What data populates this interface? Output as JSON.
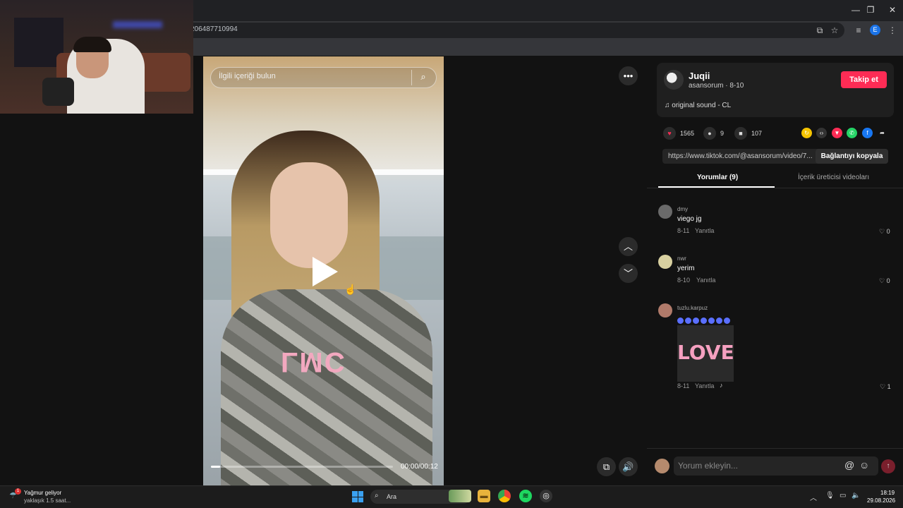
{
  "browser": {
    "url": "206487710994",
    "window_controls": [
      "—",
      "❐",
      "✕"
    ]
  },
  "video": {
    "search_placeholder": "İlgili içeriği bulun",
    "overlay_logo": "LMC",
    "time": "00:00/00:12",
    "progress_fraction": 0.05
  },
  "author": {
    "name": "Juqii",
    "subtitle": "asansorum · 8-10",
    "follow_label": "Takip et",
    "sound": "original sound - CL"
  },
  "stats": {
    "likes": "1565",
    "comments": "9",
    "saves": "107"
  },
  "link": {
    "url": "https://www.tiktok.com/@asansorum/video/7...",
    "copy_label": "Bağlantıyı kopyala"
  },
  "tabs": {
    "comments": "Yorumlar (9)",
    "creator_videos": "İçerik üreticisi videoları"
  },
  "comments": [
    {
      "user": "dmy",
      "text": "viego jg",
      "date": "8-11",
      "reply": "Yanıtla",
      "likes": "0"
    },
    {
      "user": "nwr",
      "text": "yerim",
      "date": "8-10",
      "reply": "Yanıtla",
      "likes": "0"
    },
    {
      "user": "tuzlu.karpuz",
      "text": "",
      "date": "8-11",
      "reply": "Yanıtla",
      "likes": "1",
      "sticker": "LOVE"
    }
  ],
  "comment_input": {
    "placeholder": "Yorum ekleyin..."
  },
  "taskbar": {
    "weather_title": "Yağmur geliyor",
    "weather_sub": "yaklaşık 1.5 saat...",
    "weather_badge": "1",
    "search_label": "Ara",
    "chrome_badge": "E",
    "time": "18:19",
    "date": "29.08.2026"
  },
  "colors": {
    "accent": "#fe2c55",
    "panel_bg": "#121212"
  }
}
